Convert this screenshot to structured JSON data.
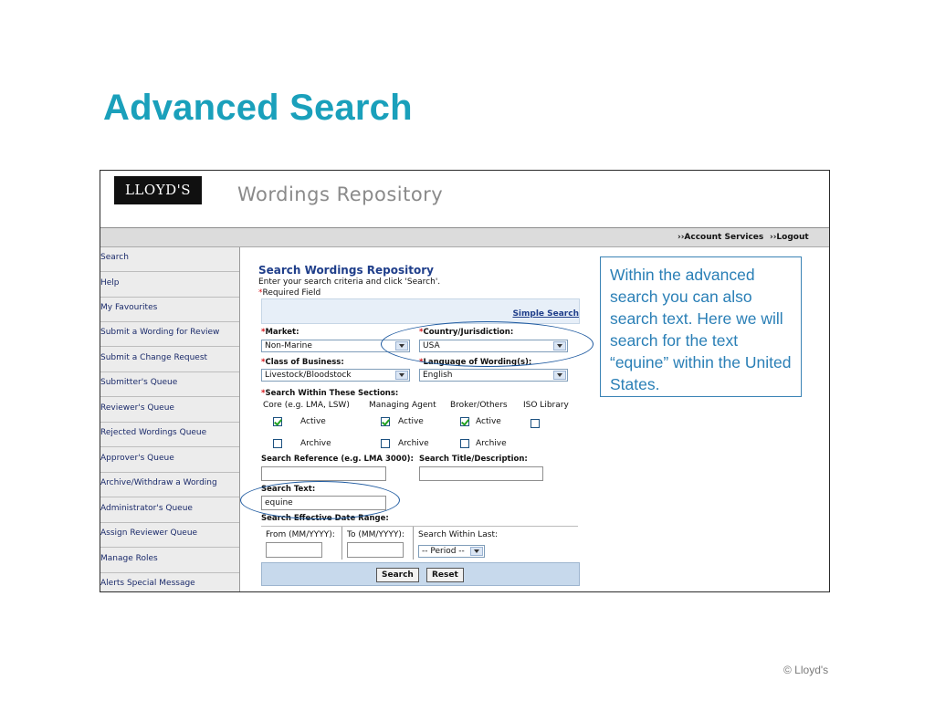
{
  "slide": {
    "title": "Advanced Search",
    "copyright": "© Lloyd's",
    "callout": "Within the advanced search you can also search text. Here we will search for the text “equine” within the United States."
  },
  "app": {
    "logo": "LLOYD'S",
    "title": "Wordings Repository",
    "topbar": {
      "account_services": "››Account Services",
      "logout": "››Logout"
    }
  },
  "sidebar": {
    "items": [
      {
        "label": "Search"
      },
      {
        "label": "Help"
      },
      {
        "label": "My Favourites"
      },
      {
        "label": "Submit a Wording for Review"
      },
      {
        "label": "Submit a Change Request"
      },
      {
        "label": "Submitter's Queue"
      },
      {
        "label": "Reviewer's Queue"
      },
      {
        "label": "Rejected Wordings Queue"
      },
      {
        "label": "Approver's Queue"
      },
      {
        "label": "Archive/Withdraw a Wording"
      },
      {
        "label": "Administrator's Queue"
      },
      {
        "label": "Assign Reviewer Queue"
      },
      {
        "label": "Manage Roles"
      },
      {
        "label": "Alerts Special Message"
      }
    ]
  },
  "form": {
    "title": "Search Wordings Repository",
    "instructions": "Enter your search criteria and click 'Search'.",
    "required_note": "Required Field",
    "required_star": "*",
    "simple_search": "Simple Search",
    "market": {
      "label": "Market:",
      "value": "Non-Marine"
    },
    "country": {
      "label": "Country/Jurisdiction:",
      "value": "USA"
    },
    "class_of_business": {
      "label": "Class of Business:",
      "value": "Livestock/Bloodstock"
    },
    "language": {
      "label": "Language of Wording(s):",
      "value": "English"
    },
    "sections": {
      "label": "Search Within These Sections:",
      "columns": [
        {
          "label": "Core (e.g. LMA, LSW)",
          "active": true,
          "archive": false
        },
        {
          "label": "Managing Agent",
          "active": true,
          "archive": false
        },
        {
          "label": "Broker/Others",
          "active": true,
          "archive": false
        },
        {
          "label": "ISO Library",
          "active": false,
          "archive": null
        }
      ],
      "active_label": "Active",
      "archive_label": "Archive"
    },
    "search_reference": {
      "label": "Search Reference (e.g. LMA 3000):",
      "value": ""
    },
    "search_title": {
      "label": "Search Title/Description:",
      "value": ""
    },
    "search_text": {
      "label": "Search Text:",
      "value": "equine"
    },
    "date_range": {
      "label": "Search Effective Date Range:",
      "from_label": "From (MM/YYYY):",
      "to_label": "To (MM/YYYY):",
      "within_label": "Search Within Last:",
      "period_value": "-- Period --"
    },
    "buttons": {
      "search": "Search",
      "reset": "Reset"
    }
  },
  "colors": {
    "title": "#1aa0bb",
    "callout_text": "#2a7fb6",
    "highlight": "#1e5aa0"
  }
}
